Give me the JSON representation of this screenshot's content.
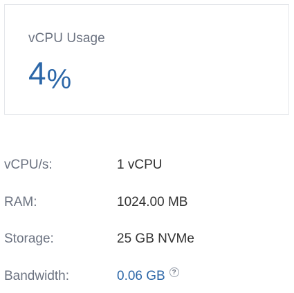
{
  "usage_card": {
    "title": "vCPU Usage",
    "value": "4",
    "unit": "%"
  },
  "specs": {
    "vcpu": {
      "label": "vCPU/s:",
      "value": "1 vCPU"
    },
    "ram": {
      "label": "RAM:",
      "value": "1024.00 MB"
    },
    "storage": {
      "label": "Storage:",
      "value": "25 GB NVMe"
    },
    "bandwidth": {
      "label": "Bandwidth:",
      "value": "0.06 GB",
      "help_icon": "question-circle-icon",
      "help_glyph": "?"
    }
  },
  "colors": {
    "accent": "#2c67a8",
    "label": "#6b7280",
    "text": "#333333",
    "border": "#e5e7eb"
  }
}
